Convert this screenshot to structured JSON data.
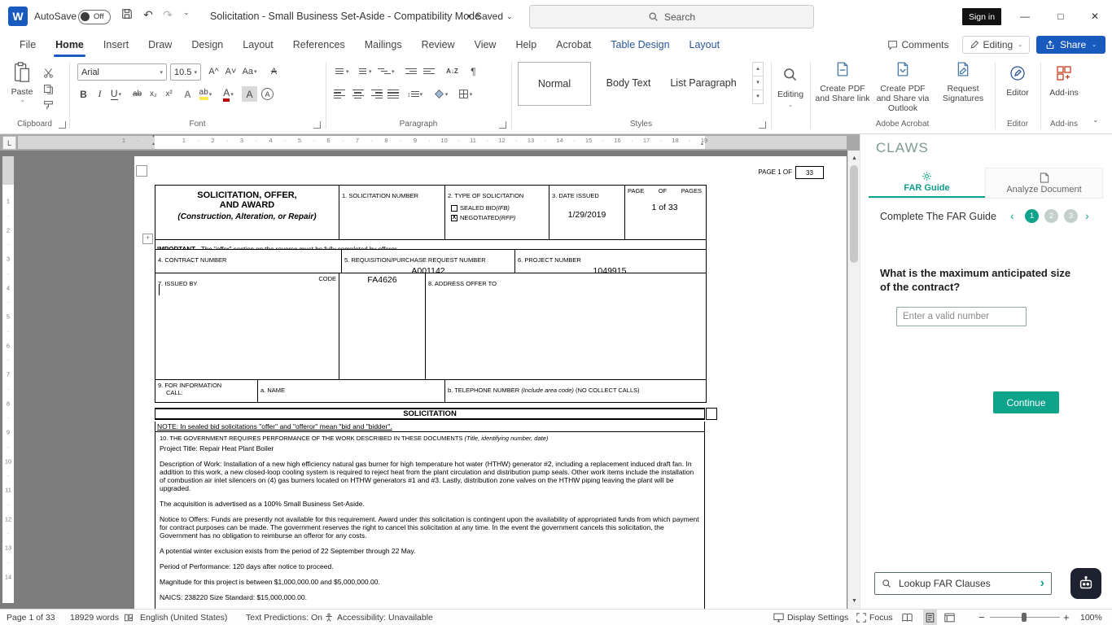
{
  "colors": {
    "word_blue": "#185abd",
    "contextual_blue": "#2b579a",
    "teal": "#0ea48c",
    "canvas_gray": "#7d7d7d"
  },
  "icons": {
    "undo": "↶",
    "redo": "↷",
    "dropdown": "▾",
    "chevron_down": "⌄",
    "bullet": "•",
    "minimize": "—",
    "maximize": "□",
    "close": "✕",
    "scroll_up": "▲",
    "scroll_down": "▼",
    "chevron_left": "‹",
    "chevron_right": "›",
    "pilcrow": "¶",
    "tab_selector": "L",
    "table_handle": "+",
    "gallery_up": "▴",
    "gallery_down": "▾",
    "indent_top_marker": "▾",
    "indent_bottom_marker": "▴"
  },
  "titlebar": {
    "autosave_label": "AutoSave",
    "autosave_state": "Off",
    "title": "Solicitation - Small Business Set-Aside  -  Compatibility Mode",
    "saved_state": "Saved",
    "search_placeholder": "Search",
    "sign_in": "Sign in"
  },
  "ribbon_tabs": {
    "items": [
      "File",
      "Home",
      "Insert",
      "Draw",
      "Design",
      "Layout",
      "References",
      "Mailings",
      "Review",
      "View",
      "Help",
      "Acrobat",
      "Table Design",
      "Layout"
    ],
    "comments": "Comments",
    "editing_mode": "Editing",
    "share": "Share"
  },
  "ribbon": {
    "clipboard": {
      "paste": "Paste",
      "label": "Clipboard"
    },
    "font": {
      "family": "Arial",
      "size": "10.5",
      "bold": "B",
      "italic": "I",
      "underline": "U",
      "strike": "ab",
      "subscript": "x₂",
      "superscript": "x²",
      "effects": "A",
      "highlight": "ab",
      "color": "A",
      "shading": "A",
      "enclose": "A",
      "grow": "A^",
      "shrink": "A˅",
      "case": "Aa",
      "clear": "A",
      "label": "Font"
    },
    "paragraph": {
      "sort": "A↓Z",
      "label": "Paragraph"
    },
    "styles": {
      "items": [
        "Normal",
        "Body Text",
        "List Paragraph"
      ],
      "label": "Styles"
    },
    "editing": {
      "label": "Editing"
    },
    "acrobat": {
      "buttons": [
        "Create PDF and Share link",
        "Create PDF and Share via Outlook",
        "Request Signatures"
      ],
      "label": "Adobe Acrobat"
    },
    "editor": {
      "button": "Editor",
      "label": "Editor"
    },
    "addins": {
      "button": "Add-ins",
      "label": "Add-ins"
    }
  },
  "rulers": {
    "tick_dot": "·",
    "h_first": 226,
    "h_step": 35.5,
    "h_count": 19,
    "h_margin_number": "1",
    "h_margin_left": 152,
    "v_first": 55,
    "v_step": 35.5,
    "v_count": 14
  },
  "document": {
    "page_label": "PAGE 1 OF",
    "page_total": "33",
    "form": {
      "title1": "SOLICITATION, OFFER,",
      "title2": "AND AWARD",
      "title3": "(Construction, Alteration, or Repair)",
      "f1": "1. SOLICITATION NUMBER",
      "f2": "2. TYPE OF SOLICITATION",
      "f2_opt1": "SEALED BID ",
      "f2_opt1_it": "(IFB)",
      "f2_opt2": "NEGOTIATED ",
      "f2_opt2_it": "(RFP)",
      "f2_mark": "X",
      "f3": "3. DATE ISSUED",
      "f3_value": "1/29/2019",
      "pg1": "PAGE",
      "pg2": "OF",
      "pg3": "PAGES",
      "pg_value": "1 of 33",
      "important_b": "IMPORTANT",
      "important_rest": " - The \"offer\" section on the reverse must be fully completed by offeror.",
      "f4": "4. CONTRACT NUMBER",
      "f5": "5. REQUISITION/PURCHASE REQUEST NUMBER",
      "f5_value": "A001142",
      "f6": "6. PROJECT NUMBER",
      "f6_value": "1049915",
      "f7": "7. ISSUED BY",
      "f7_code": "CODE",
      "f7_value": "FA4626",
      "f8": "8. ADDRESS OFFER TO",
      "f9_line1": "9. FOR INFORMATION",
      "f9_line2": "CALL:",
      "f9_name": "a. NAME",
      "f9b_pre": "b. TELEPHONE NUMBER ",
      "f9b_it": "(Include area code)",
      "f9b_post": " (NO COLLECT CALLS)",
      "band": "SOLICITATION",
      "note": "NOTE:  In sealed bid solicitations \"offer\" and \"offeror\" mean \"bid and \"bidder\".",
      "f10": "10. THE GOVERNMENT REQUIRES PERFORMANCE OF THE WORK DESCRIBED IN THESE DOCUMENTS ",
      "f10_it": "(Title, identifying number, date)",
      "p_title": "Project Title: Repair Heat Plant Boiler",
      "p_desc": "Description of Work: Installation of a new high efficiency natural gas burner for high temperature hot water (HTHW) generator #2, including a replacement induced draft fan. In addition to this work, a new closed-loop cooling system is required to reject heat from the plant circulation and distribution pump seals. Other work items include the installation of combustion air inlet silencers on (4) gas burners located on HTHW generators #1 and #3. Lastly, distribution zone valves on the HTHW piping leaving the plant will be upgraded.",
      "p_acq": "The acquisition is advertised as a 100% Small Business Set-Aside.",
      "p_notice": "Notice to Offers: Funds are presently not available for this requirement. Award under this solicitation is contingent upon the availability of appropriated funds from which payment for contract purposes can be made. The government reserves the right to cancel this solicitation at any time. In the event the government cancels this solicitation, the Government has no obligation to reimburse an offeror for any costs.",
      "p_winter": "A potential winter exclusion exists from the period of 22 September through 22 May.",
      "p_pop": "Period of Performance: 120 days after notice to proceed.",
      "p_mag": "Magnitude for this project is between $1,000,000.00 and $5,000,000.00.",
      "p_naics": "NAICS: 238220 Size Standard: $15,000,000.00."
    }
  },
  "claws": {
    "title": "CLAWS",
    "tab_far": "FAR Guide",
    "tab_analyze": "Analyze Document",
    "progress_label": "Complete The FAR Guide",
    "steps": [
      "1",
      "2",
      "3"
    ],
    "question1": "What is the maximum anticipated size",
    "question2": "of the contract?",
    "input_placeholder": "Enter a valid number",
    "continue_label": "Continue",
    "lookup_placeholder": "Lookup FAR Clauses"
  },
  "statusbar": {
    "page": "Page 1 of 33",
    "words": "18929 words",
    "language": "English (United States)",
    "predictions": "Text Predictions: On",
    "accessibility": "Accessibility: Unavailable",
    "display_settings": "Display Settings",
    "focus": "Focus",
    "zoom": "100%"
  }
}
